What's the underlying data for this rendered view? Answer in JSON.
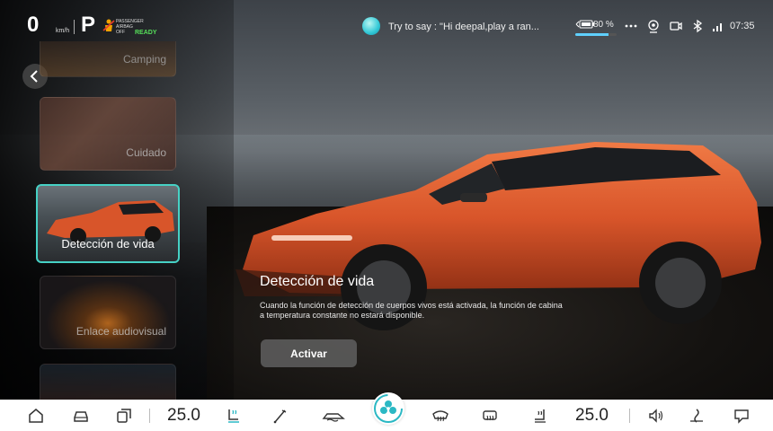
{
  "status": {
    "speed": "0",
    "speed_unit": "km/h",
    "gear": "P",
    "airbag_text": "PASSENGER AIRBAG OFF",
    "ready": "READY",
    "assistant_hint": "Try to say : \"Hi deepal,play a ran...",
    "battery": "80 %",
    "battery_level": 0.8,
    "time": "07:35",
    "icons": [
      "more-icon",
      "camera-icon",
      "record-icon",
      "bluetooth-icon",
      "signal-icon"
    ]
  },
  "sidebar": {
    "items": [
      {
        "label": "Camping",
        "selected": false
      },
      {
        "label": "Cuidado",
        "selected": false
      },
      {
        "label": "Detección de vida",
        "selected": true
      },
      {
        "label": "Enlace audiovisual",
        "selected": false
      },
      {
        "label": "",
        "selected": false
      }
    ]
  },
  "main": {
    "title": "Detección de vida",
    "description": "Cuando la función de detección de cuerpos vivos está activada, la función de cabina a temperatura constante no estará disponible.",
    "button": "Activar"
  },
  "dock": {
    "left_temp": "25.0",
    "right_temp": "25.0",
    "icons": [
      "home-icon",
      "car-icon",
      "apps-icon",
      "seat-heat-icon",
      "wiper-icon",
      "car-air-icon",
      "fan-icon",
      "front-defrost-icon",
      "rear-defrost-icon",
      "seat-vent-icon",
      "volume-icon",
      "ac-flow-icon",
      "message-icon"
    ],
    "accent": "#2bb8c4"
  },
  "colors": {
    "selected_border": "#46d1c5",
    "ready_green": "#56e05a",
    "car_orange": "#d8552a"
  }
}
